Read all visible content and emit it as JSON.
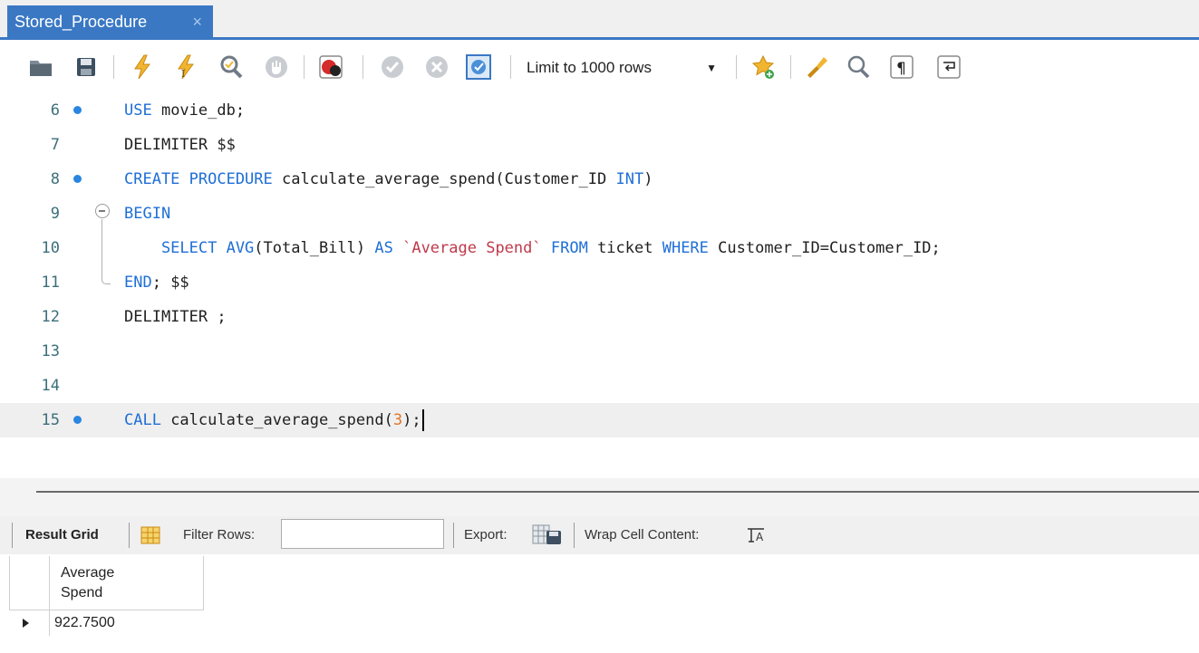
{
  "tab": {
    "title": "Stored_Procedure",
    "close_label": "×"
  },
  "toolbar": {
    "limit_label": "Limit to 1000 rows",
    "icons": [
      "open-folder-icon",
      "save-icon",
      "execute-icon",
      "execute-current-icon",
      "explain-icon",
      "stop-icon",
      "toggle-stop-on-error-icon",
      "commit-icon",
      "rollback-icon",
      "autocommit-icon",
      "add-snippet-icon",
      "beautify-icon",
      "find-icon",
      "invisible-chars-icon",
      "wrap-icon"
    ],
    "accent": "#3a78c4"
  },
  "editor": {
    "lines": [
      {
        "num": "6",
        "dot": true
      },
      {
        "num": "7",
        "dot": false
      },
      {
        "num": "8",
        "dot": true
      },
      {
        "num": "9",
        "dot": false
      },
      {
        "num": "10",
        "dot": false
      },
      {
        "num": "11",
        "dot": false
      },
      {
        "num": "12",
        "dot": false
      },
      {
        "num": "13",
        "dot": false
      },
      {
        "num": "14",
        "dot": false
      },
      {
        "num": "15",
        "dot": true
      }
    ],
    "tokens": {
      "l6": [
        "USE",
        " movie_db;"
      ],
      "l7": [
        "DELIMITER $$"
      ],
      "l8": [
        "CREATE PROCEDURE",
        " calculate_average_spend(Customer_ID ",
        "INT",
        ")"
      ],
      "l9": [
        "BEGIN"
      ],
      "l10": [
        "    SELECT AVG",
        "(Total_Bill) ",
        "AS",
        " ",
        "`Average Spend`",
        " ",
        "FROM",
        " ticket ",
        "WHERE",
        " Customer_ID=Customer_ID;"
      ],
      "l11": [
        "END",
        "; $$"
      ],
      "l12": [
        "DELIMITER ;"
      ],
      "l15": [
        "CALL",
        " calculate_average_spend(",
        "3",
        ");"
      ]
    }
  },
  "result": {
    "grid_label": "Result Grid",
    "filter_label": "Filter Rows:",
    "filter_value": "",
    "export_label": "Export:",
    "wrap_label": "Wrap Cell Content:",
    "column_line1": "Average",
    "column_line2": "Spend",
    "value": "922.7500"
  }
}
